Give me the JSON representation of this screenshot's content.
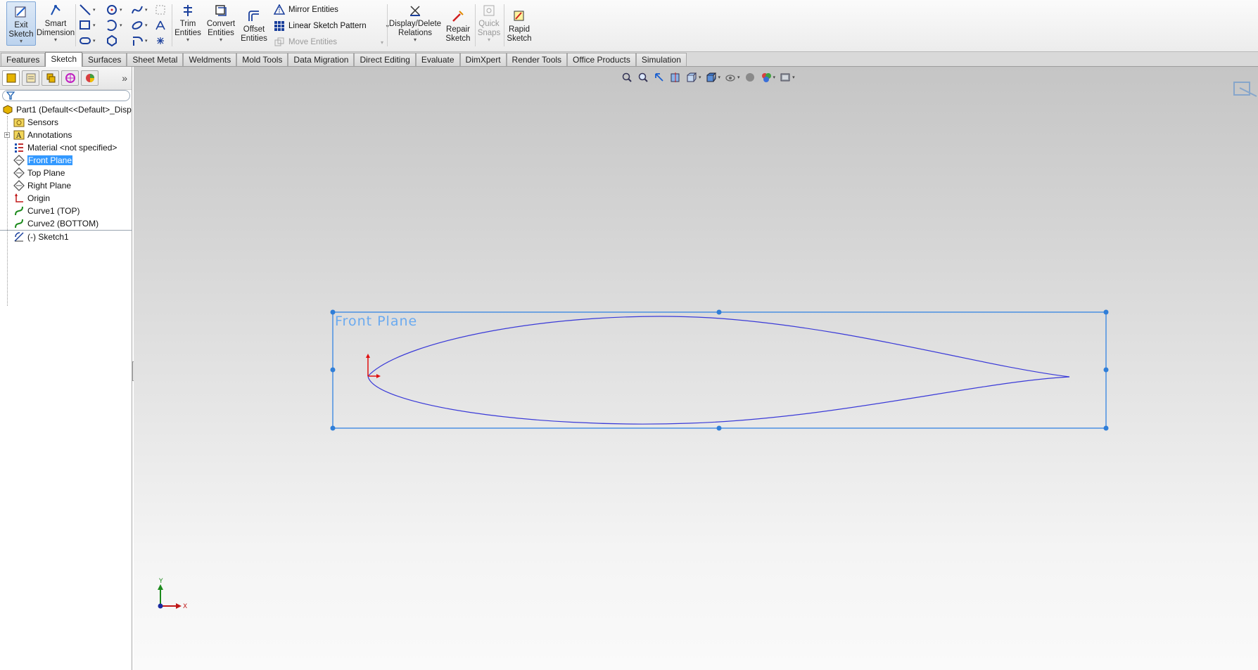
{
  "ribbon": {
    "exit_sketch": "Exit\nSketch",
    "smart_dimension": "Smart\nDimension",
    "trim_entities": "Trim\nEntities",
    "convert_entities": "Convert\nEntities",
    "offset_entities": "Offset\nEntities",
    "mirror_entities": "Mirror Entities",
    "linear_sketch_pattern": "Linear Sketch Pattern",
    "move_entities": "Move Entities",
    "display_delete_relations": "Display/Delete\nRelations",
    "repair_sketch": "Repair\nSketch",
    "quick_snaps": "Quick\nSnaps",
    "rapid_sketch": "Rapid\nSketch"
  },
  "tabs": [
    {
      "label": "Features"
    },
    {
      "label": "Sketch"
    },
    {
      "label": "Surfaces"
    },
    {
      "label": "Sheet Metal"
    },
    {
      "label": "Weldments"
    },
    {
      "label": "Mold Tools"
    },
    {
      "label": "Data Migration"
    },
    {
      "label": "Direct Editing"
    },
    {
      "label": "Evaluate"
    },
    {
      "label": "DimXpert"
    },
    {
      "label": "Render Tools"
    },
    {
      "label": "Office Products"
    },
    {
      "label": "Simulation"
    }
  ],
  "active_tab": "Sketch",
  "tree": {
    "root": "Part1  (Default<<Default>_Disp",
    "items": [
      {
        "label": "Sensors",
        "icon": "sensor-folder-icon"
      },
      {
        "label": "Annotations",
        "icon": "annotations-icon"
      },
      {
        "label": "Material <not specified>",
        "icon": "material-icon"
      },
      {
        "label": "Front Plane",
        "icon": "plane-icon"
      },
      {
        "label": "Top Plane",
        "icon": "plane-icon"
      },
      {
        "label": "Right Plane",
        "icon": "plane-icon"
      },
      {
        "label": "Origin",
        "icon": "origin-icon"
      },
      {
        "label": "Curve1 (TOP)",
        "icon": "curve-icon"
      },
      {
        "label": "Curve2 (BOTTOM)",
        "icon": "curve-icon"
      },
      {
        "label": "(-) Sketch1",
        "icon": "sketch-icon"
      }
    ],
    "selected": "Front Plane"
  },
  "viewport": {
    "plane_label": "Front Plane",
    "triad_y": "Y",
    "triad_x": "X"
  },
  "colors": {
    "selection": "#3399ff",
    "plane_outline": "#4a90e2",
    "curve": "#3a3ad8",
    "origin": "#e01010"
  }
}
